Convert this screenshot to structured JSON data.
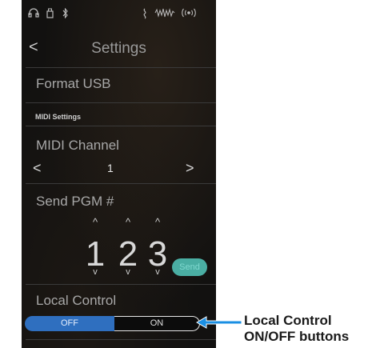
{
  "status_bar": {
    "icons": [
      "headphones-icon",
      "usb-icon",
      "bluetooth-icon",
      "metronome-icon",
      "sound-wave-icon",
      "wireless-icon"
    ]
  },
  "header": {
    "title": "Settings",
    "back_symbol": "<"
  },
  "settings": {
    "format_usb": "Format USB",
    "section_label": "MIDI Settings",
    "midi_channel": {
      "label": "MIDI Channel",
      "value": "1",
      "prev_symbol": "<",
      "next_symbol": ">"
    },
    "send_pgm": {
      "label": "Send PGM #",
      "digits": [
        "1",
        "2",
        "3"
      ],
      "up_symbol": "^",
      "down_symbol": "v",
      "send_label": "Send"
    },
    "local_control": {
      "label": "Local Control",
      "off_label": "OFF",
      "on_label": "ON",
      "selected": "OFF"
    }
  },
  "callout": {
    "line1": "Local Control",
    "line2": "ON/OFF buttons"
  },
  "colors": {
    "selected_blue": "#2f6fbf",
    "send_teal": "#4aaea3",
    "callout_arrow": "#1a8fe3"
  }
}
